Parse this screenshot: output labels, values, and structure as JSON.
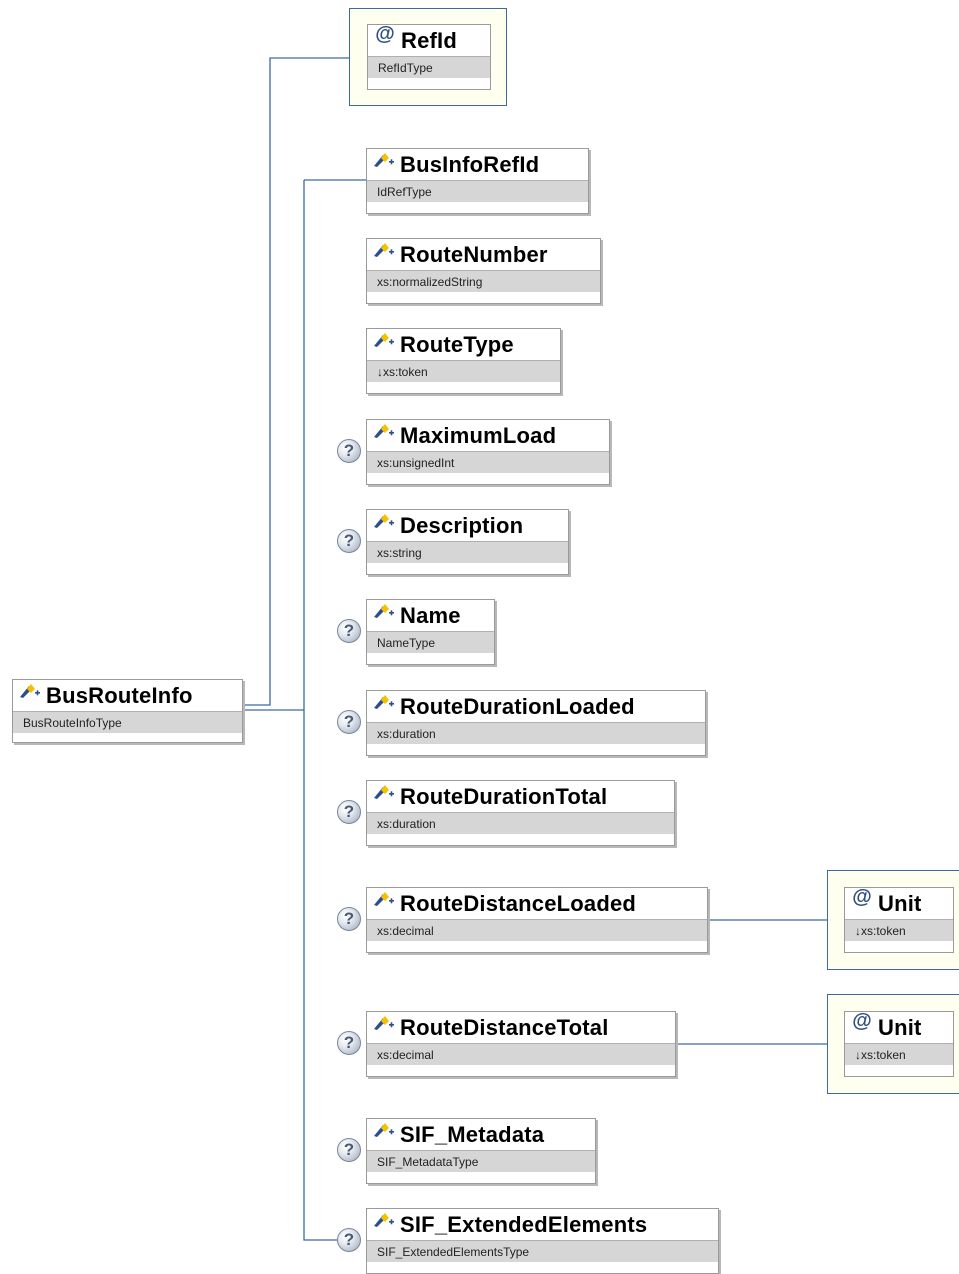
{
  "root": {
    "name": "BusRouteInfo",
    "type": "BusRouteInfoType"
  },
  "attribute": {
    "symbol": "@",
    "name": "RefId",
    "type": "RefIdType"
  },
  "elements": [
    {
      "name": "BusInfoRefId",
      "type": "IdRefType",
      "optional": false
    },
    {
      "name": "RouteNumber",
      "type": "xs:normalizedString",
      "optional": false
    },
    {
      "name": "RouteType",
      "type": "↓xs:token",
      "optional": false
    },
    {
      "name": "MaximumLoad",
      "type": "xs:unsignedInt",
      "optional": true
    },
    {
      "name": "Description",
      "type": "xs:string",
      "optional": true
    },
    {
      "name": "Name",
      "type": "NameType",
      "optional": true
    },
    {
      "name": "RouteDurationLoaded",
      "type": "xs:duration",
      "optional": true
    },
    {
      "name": "RouteDurationTotal",
      "type": "xs:duration",
      "optional": true
    },
    {
      "name": "RouteDistanceLoaded",
      "type": "xs:decimal",
      "optional": true,
      "attribute": {
        "symbol": "@",
        "name": "Unit",
        "type": "↓xs:token"
      }
    },
    {
      "name": "RouteDistanceTotal",
      "type": "xs:decimal",
      "optional": true,
      "attribute": {
        "symbol": "@",
        "name": "Unit",
        "type": "↓xs:token"
      }
    },
    {
      "name": "SIF_Metadata",
      "type": "SIF_MetadataType",
      "optional": true
    },
    {
      "name": "SIF_ExtendedElements",
      "type": "SIF_ExtendedElementsType",
      "optional": true
    }
  ],
  "optional_marker": "?",
  "colors": {
    "connector": "#3d6a9e",
    "type_band": "#d6d6d6",
    "attr_bg": "#fffff0"
  },
  "icons": {
    "element": "element-icon",
    "attribute": "at-sign-icon",
    "optional": "question-mark-icon"
  }
}
